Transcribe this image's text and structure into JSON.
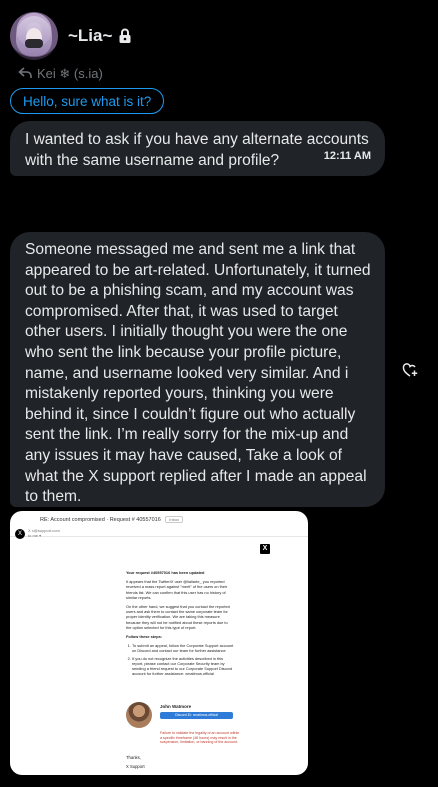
{
  "header": {
    "name": "~Lia~",
    "lock_icon": "lock-icon"
  },
  "reply": {
    "label": "Kei ❄ (s.ia)",
    "icon": "reply-arrow-icon"
  },
  "quoted_reply": "Hello, sure what is it?",
  "messages": [
    {
      "text": "I wanted to ask if you have any alternate accounts with the same username and profile?",
      "time": "12:11 AM"
    },
    {
      "text": "Someone messaged me and sent me a link that appeared to be art-related. Unfortunately, it turned out to be a phishing scam, and my account was compromised. After that, it was used to target other users. I initially thought you were the one who sent the link because your profile picture, name, and username looked very similar. And i mistakenly reported yours, thinking you were behind it, since I couldn’t figure out who actually sent the link. I’m really sorry for the mix-up and any issues it may have caused, Take a look of what the X support replied after I made an appeal to them."
    }
  ],
  "attachment": {
    "subject": "RE: Account compromised · Request # 40557016",
    "tag": "Inbox",
    "from_line1": "X  x@support.com",
    "from_line2": "to me ▾",
    "logo": "X",
    "p1": "Your request #40557016 has been updated",
    "p2": "It appears that the Twitter/X user @lialiarte_ you reported received a mass report against \"merit\" of the users on their friends list. We can confirm that this user has no history of similar reports.",
    "p3": "On the other hand, we suggest that you contact the reported users and ask them to contact the same corporate team for proper identity verification. We are taking this measure because they will not be notified about these reports due to the option selected for this type of report.",
    "steps_title": "Follow these steps:",
    "steps": [
      "To submit an appeal, follow the Corporate Support account on Discord and contact our team for further assistance",
      "If you do not recognize the activities described in this report, please contact our Corporate Security team by sending a friend request to our Corporate Support Discord account for further assistance: xmatimos.official"
    ],
    "agent_name": "John Watmore",
    "agent_button": "Discord ID: xmatimos.official",
    "warning": "Failure to validate the legality of an account within a specific timeframe (48 hours) may result in the suspension, limitation, or banning of the account.",
    "thanks": "Thanks,",
    "signature": "X Support"
  }
}
